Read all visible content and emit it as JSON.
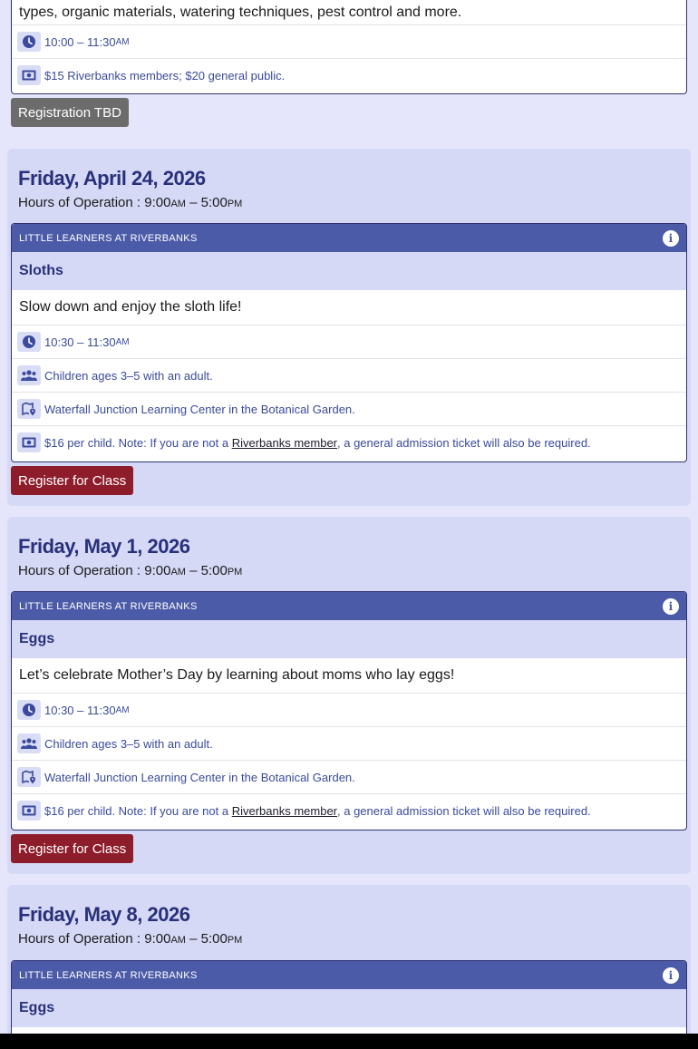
{
  "top_card": {
    "description_tail": "types, organic materials, watering techniques, pest control and more.",
    "time_start": "10:00 – 11:30",
    "time_suffix": "AM",
    "price": "$15 Riverbanks members; $20 general public."
  },
  "top_button": "Registration TBD",
  "days": [
    {
      "date": "Friday, April 24, 2026",
      "hours_label": "Hours of Operation : 9:00",
      "hours_am": "AM",
      "hours_dash": " – 5:00",
      "hours_pm": "PM",
      "category": "LITTLE LEARNERS AT RIVERBANKS",
      "title": "Sloths",
      "description": "Slow down and enjoy the sloth life!",
      "time_start": "10:30 – 11:30",
      "time_suffix": "AM",
      "audience": "Children ages 3–5 with an adult.",
      "location": "Waterfall Junction Learning Center in the Botanical Garden.",
      "price_pre": "$16 per child. Note: If you are not a ",
      "price_link": "Riverbanks member",
      "price_post": ", a general admission ticket will also be required.",
      "button": "Register for Class"
    },
    {
      "date": "Friday, May 1, 2026",
      "hours_label": "Hours of Operation : 9:00",
      "hours_am": "AM",
      "hours_dash": " – 5:00",
      "hours_pm": "PM",
      "category": "LITTLE LEARNERS AT RIVERBANKS",
      "title": "Eggs",
      "description": "Let’s celebrate Mother’s Day by learning about moms who lay eggs!",
      "time_start": "10:30 – 11:30",
      "time_suffix": "AM",
      "audience": "Children ages 3–5 with an adult.",
      "location": "Waterfall Junction Learning Center in the Botanical Garden.",
      "price_pre": "$16 per child. Note: If you are not a ",
      "price_link": "Riverbanks member",
      "price_post": ", a general admission ticket will also be required.",
      "button": "Register for Class"
    },
    {
      "date": "Friday, May 8, 2026",
      "hours_label": "Hours of Operation : 9:00",
      "hours_am": "AM",
      "hours_dash": " – 5:00",
      "hours_pm": "PM",
      "category": "LITTLE LEARNERS AT RIVERBANKS",
      "title": "Eggs"
    }
  ],
  "colors": {
    "page_bg": "#e5e6fb",
    "section_bg": "#d6d9f6",
    "header_bg": "#4b5ba8",
    "heading": "#28307a",
    "link_text": "#3a4a9c",
    "register_button": "#8e1d2b",
    "tbd_button": "#6c6c6c"
  },
  "icons": {
    "time": "clock-icon",
    "audience": "group-icon",
    "location": "map-pin-icon",
    "price": "money-icon",
    "info": "info-icon"
  }
}
